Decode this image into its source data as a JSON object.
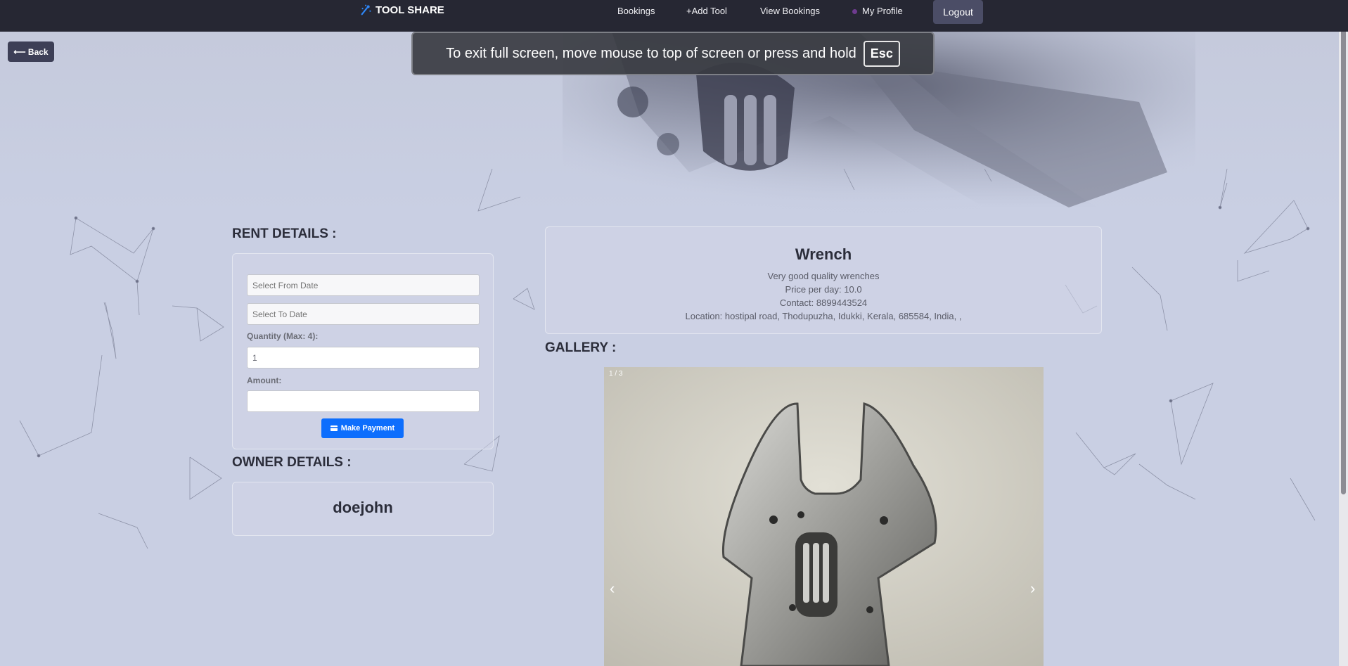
{
  "nav": {
    "brand": "TOOL SHARE",
    "links": [
      "Bookings",
      "+Add Tool",
      "View Bookings",
      "My Profile"
    ],
    "logout": "Logout"
  },
  "back_label": "⟵ Back",
  "fullscreen": {
    "message": "To exit full screen, move mouse to top of screen or press and hold",
    "key": "Esc"
  },
  "rent": {
    "title": "RENT DETAILS :",
    "from_placeholder": "Select From Date",
    "to_placeholder": "Select To Date",
    "quantity_label": "Quantity (Max: 4):",
    "quantity_value": "1",
    "amount_label": "Amount:",
    "amount_value": "",
    "pay_label": "Make Payment"
  },
  "owner": {
    "title": "OWNER DETAILS :",
    "name": "doejohn"
  },
  "tool": {
    "name": "Wrench",
    "description": "Very good quality wrenches",
    "price": "Price per day: 10.0",
    "contact": "Contact: 8899443524",
    "location": "Location: hostipal road, Thodupuzha, Idukki, Kerala, 685584, India, ,"
  },
  "gallery": {
    "title": "GALLERY :",
    "counter": "1 / 3",
    "prev": "‹",
    "next": "›"
  },
  "colors": {
    "nav_bg": "#262733",
    "page_bg": "#c9cfe3",
    "accent": "#0d6efd"
  }
}
